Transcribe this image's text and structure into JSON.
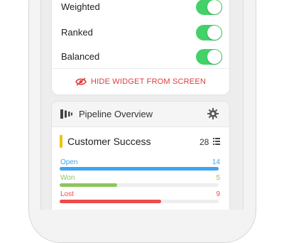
{
  "settings": {
    "toggles": [
      {
        "label": "Weighted",
        "on": true
      },
      {
        "label": "Ranked",
        "on": true
      },
      {
        "label": "Balanced",
        "on": true
      }
    ],
    "hide_label": "HIDE WIDGET FROM SCREEN"
  },
  "pipeline": {
    "title": "Pipeline Overview",
    "team": "Customer Success",
    "total": "28",
    "stats": [
      {
        "label": "Open",
        "value": "14",
        "fraction": 1.0,
        "color": "#3fa3f0"
      },
      {
        "label": "Won",
        "value": "5",
        "fraction": 0.36,
        "color": "#8cc65a"
      },
      {
        "label": "Lost",
        "value": "9",
        "fraction": 0.64,
        "color": "#ef4b4b"
      }
    ]
  },
  "colors": {
    "toggle_on": "#43d16a",
    "danger": "#e23b3b",
    "team_accent": "#f1c40f"
  },
  "icons": [
    "eye-slash-icon",
    "pipeline-icon",
    "gear-icon",
    "list-icon"
  ]
}
